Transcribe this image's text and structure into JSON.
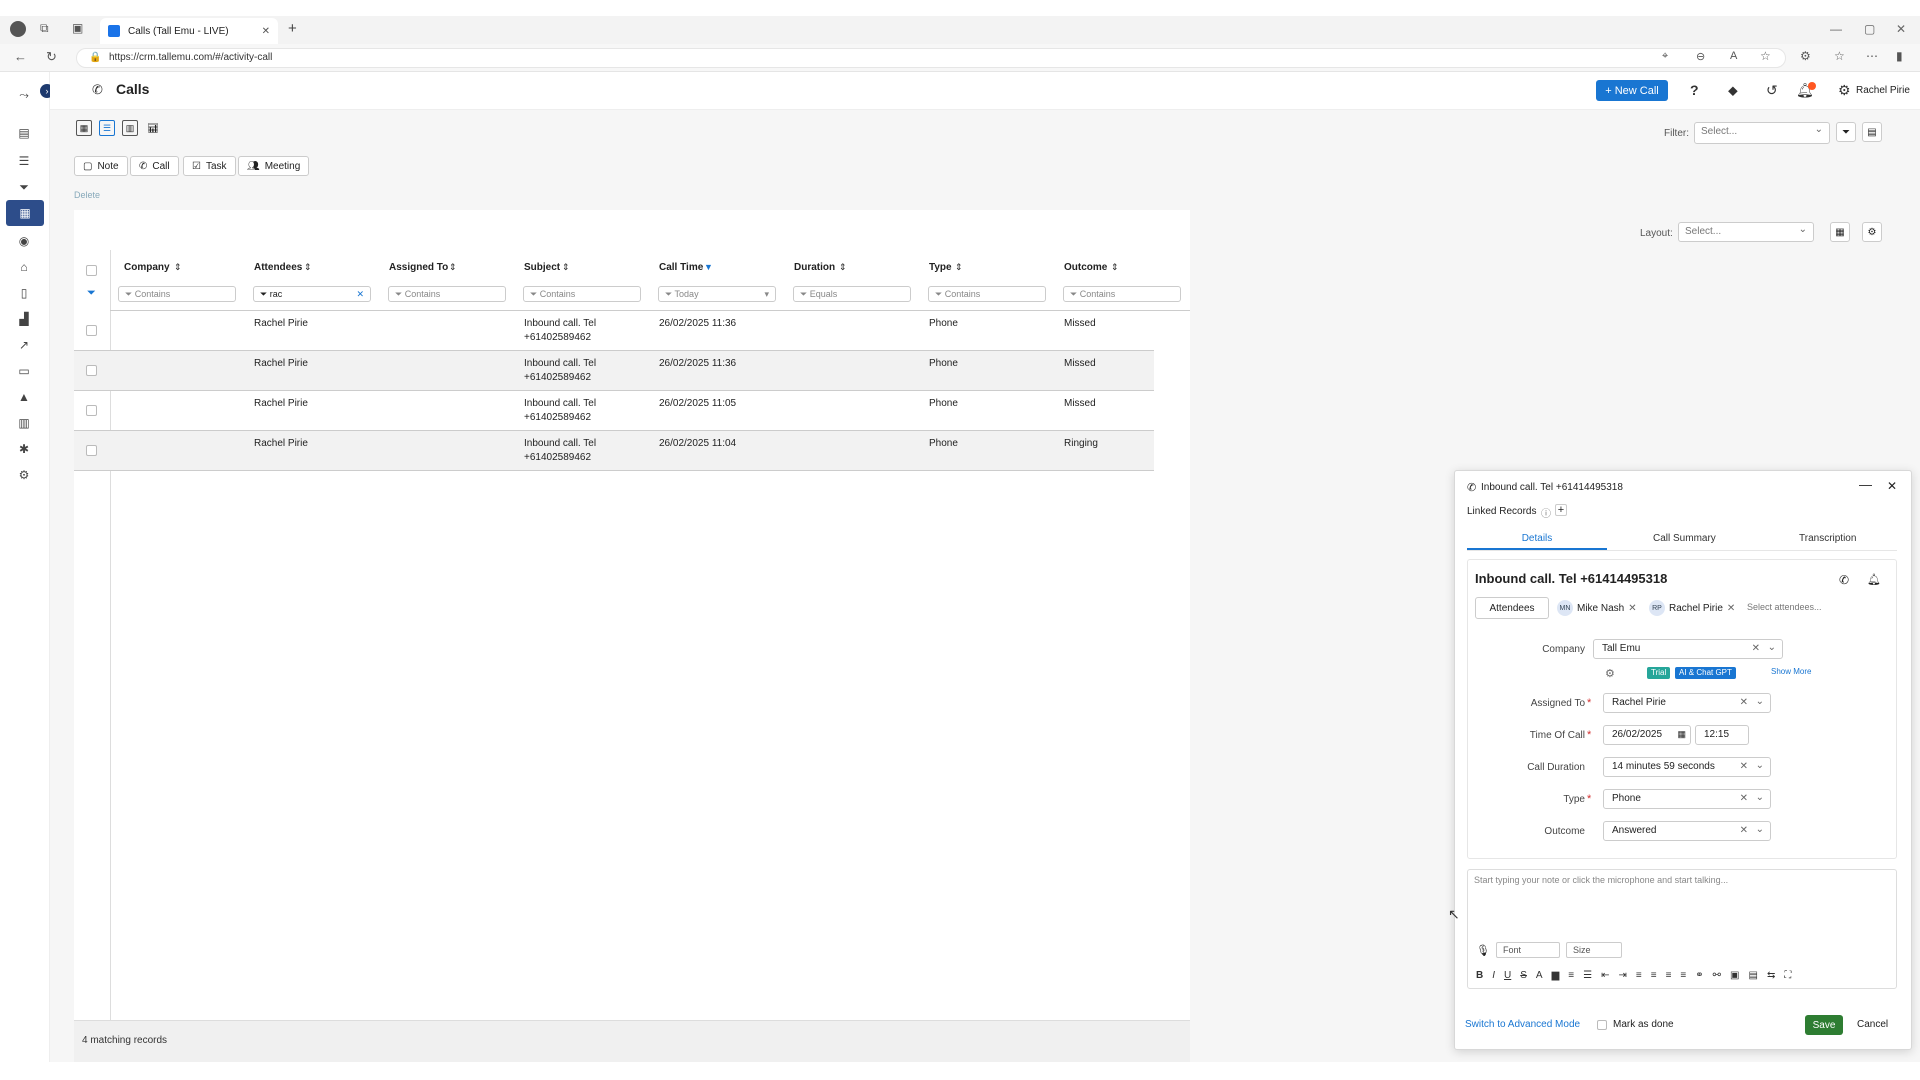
{
  "browser": {
    "tab_title": "Calls (Tall Emu - LIVE)",
    "new_tab": "+",
    "url": "https://crm.tallemu.com/#/activity-call"
  },
  "header": {
    "title": "Calls",
    "new_call_label": "+ New Call",
    "user_name": "Rachel Pirie"
  },
  "toolbar": {
    "note": "Note",
    "call": "Call",
    "task": "Task",
    "meeting": "Meeting",
    "delete": "Delete",
    "filter_label": "Filter:",
    "filter_placeholder": "Select...",
    "layout_label": "Layout:",
    "layout_placeholder": "Select..."
  },
  "table": {
    "columns": [
      "Company",
      "Attendees",
      "Assigned To",
      "Subject",
      "Call Time",
      "Duration",
      "Type",
      "Outcome"
    ],
    "filters": [
      "Contains",
      "rac",
      "Contains",
      "Contains",
      "Today",
      "Equals",
      "Contains",
      "Contains"
    ],
    "rows": [
      {
        "attendee": "Rachel Pirie",
        "subject1": "Inbound call. Tel",
        "subject2": "+61402589462",
        "time": "26/02/2025 11:36",
        "type": "Phone",
        "outcome": "Missed"
      },
      {
        "attendee": "Rachel Pirie",
        "subject1": "Inbound call. Tel",
        "subject2": "+61402589462",
        "time": "26/02/2025 11:36",
        "type": "Phone",
        "outcome": "Missed"
      },
      {
        "attendee": "Rachel Pirie",
        "subject1": "Inbound call. Tel",
        "subject2": "+61402589462",
        "time": "26/02/2025 11:05",
        "type": "Phone",
        "outcome": "Missed"
      },
      {
        "attendee": "Rachel Pirie",
        "subject1": "Inbound call. Tel",
        "subject2": "+61402589462",
        "time": "26/02/2025 11:04",
        "type": "Phone",
        "outcome": "Ringing"
      }
    ],
    "footer": "4 matching records"
  },
  "dialog": {
    "title": "Inbound call. Tel +61414495318",
    "linked_records": "Linked Records",
    "tabs": [
      "Details",
      "Call Summary",
      "Transcription"
    ],
    "heading": "Inbound call. Tel +61414495318",
    "attendees_label": "Attendees",
    "attendees": [
      {
        "initials": "MN",
        "name": "Mike Nash"
      },
      {
        "initials": "RP",
        "name": "Rachel Pirie"
      }
    ],
    "select_attendees": "Select attendees...",
    "company_label": "Company",
    "company_value": "Tall Emu",
    "badge_trial": "Trial",
    "badge_ai": "AI & Chat GPT",
    "show_more": "Show More",
    "assigned_label": "Assigned To",
    "assigned_value": "Rachel Pirie",
    "time_label": "Time Of Call",
    "date_value": "26/02/2025",
    "time_value": "12:15",
    "duration_label": "Call Duration",
    "duration_value": "14 minutes 59 seconds",
    "type_label": "Type",
    "type_value": "Phone",
    "outcome_label": "Outcome",
    "outcome_value": "Answered",
    "note_placeholder": "Start typing your note or click the microphone and start talking...",
    "font_label": "Font",
    "size_label": "Size",
    "advanced_mode": "Switch to Advanced Mode",
    "mark_done": "Mark as done",
    "save": "Save",
    "cancel": "Cancel"
  },
  "colors": {
    "primary": "#1976d2",
    "sidebar_active": "#2d4d8a",
    "save": "#2e7d32",
    "trial": "#26a69a"
  }
}
